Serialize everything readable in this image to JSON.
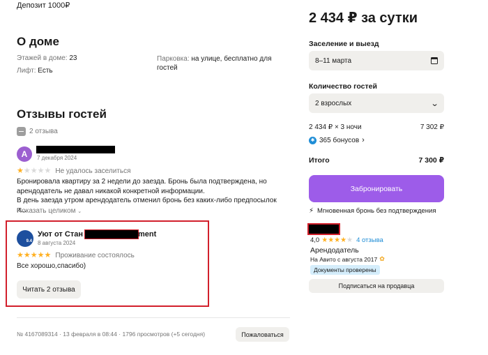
{
  "deposit": "Депозит 1000₽",
  "about": {
    "title": "О доме",
    "floors_label": "Этажей в доме:",
    "floors_value": "23",
    "lift_label": "Лифт:",
    "lift_value": "Есть",
    "parking_label": "Парковка:",
    "parking_value": "на улице, бесплатно для гостей"
  },
  "reviews": {
    "title": "Отзывы гостей",
    "count_label": "2 отзыва",
    "items": [
      {
        "avatar_letter": "A",
        "date": "7 декабря 2024",
        "rating": 1,
        "status": "Не удалось заселиться",
        "text": "Бронировала квартиру за 2 недели до заезда. Бронь была подтверждена, но арендодатель не давал никакой конкретной информации.",
        "text2": "В день заезда утром арендодатель отменил бронь без каких-либо предпосылок и...",
        "show_more": "Показать целиком"
      }
    ],
    "host_reply": {
      "name_prefix": "Уют от Стан",
      "name_suffix": "ment",
      "avatar_badge": "9.4",
      "date": "8 августа 2024",
      "rating": 5,
      "status": "Проживание состоялось",
      "text": "Все хорошо,спасибо)",
      "read_button": "Читать 2 отзыва"
    }
  },
  "footer": {
    "meta": "№ 4167089314 · 13 февраля в 08:44 · 1796 просмотров (+5 сегодня)",
    "report_button": "Пожаловаться"
  },
  "booking": {
    "price_title": "2 434 ₽ за сутки",
    "dates_label": "Заселение и выезд",
    "dates_value": "8–11 марта",
    "guests_label": "Количество гостей",
    "guests_value": "2 взрослых",
    "calc_label": "2 434 ₽ × 3 ночи",
    "calc_value": "7 302 ₽",
    "bonus": "365 бонусов",
    "total_label": "Итого",
    "total_value": "7 300 ₽",
    "book_button": "Забронировать",
    "instant_text": "Мгновенная бронь без подтверждения"
  },
  "seller": {
    "rating": "4,0",
    "rating_stars": 4,
    "reviews_link": "4 отзыва",
    "role": "Арендодатель",
    "since": "На Авито с августа 2017",
    "verified": "Документы проверены",
    "subscribe_button": "Подписаться на продавца"
  },
  "colors": {
    "accent_purple": "#9d5ce9",
    "star_gold": "#ffb021",
    "link_blue": "#1f8dd6",
    "highlight_red": "#d21f2b",
    "verified_bg": "#d4edfb"
  }
}
